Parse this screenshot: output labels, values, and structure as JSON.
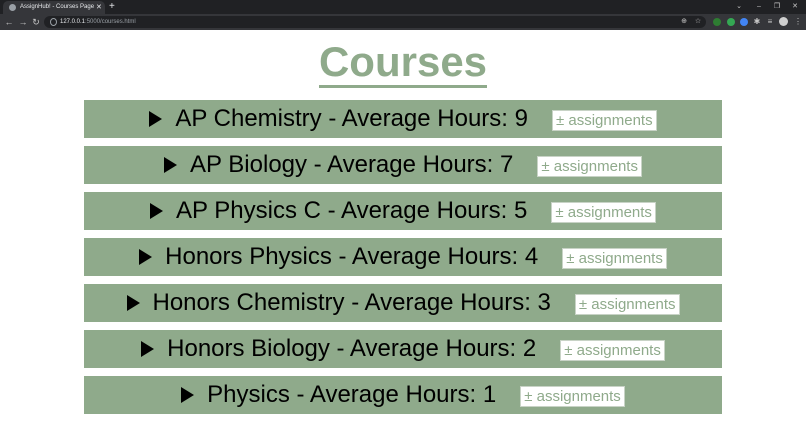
{
  "browser": {
    "tab_title": "AssignHub! - Courses Page",
    "tab_close": "✕",
    "new_tab": "+",
    "url_host": "127.0.0.1",
    "url_path": ":5000/courses.html"
  },
  "page": {
    "title": "Courses",
    "courses": [
      {
        "label": "AP Chemistry - Average Hours: 9",
        "button": "± assignments"
      },
      {
        "label": "AP Biology - Average Hours: 7",
        "button": "± assignments"
      },
      {
        "label": "AP Physics C - Average Hours: 5",
        "button": "± assignments"
      },
      {
        "label": "Honors Physics - Average Hours: 4",
        "button": "± assignments"
      },
      {
        "label": "Honors Chemistry - Average Hours: 3",
        "button": "± assignments"
      },
      {
        "label": "Honors Biology - Average Hours: 2",
        "button": "± assignments"
      },
      {
        "label": "Physics - Average Hours: 1",
        "button": "± assignments"
      }
    ]
  },
  "colors": {
    "accent": "#8faa8b",
    "chrome_dark": "#202124",
    "chrome_toolbar": "#35363a"
  }
}
